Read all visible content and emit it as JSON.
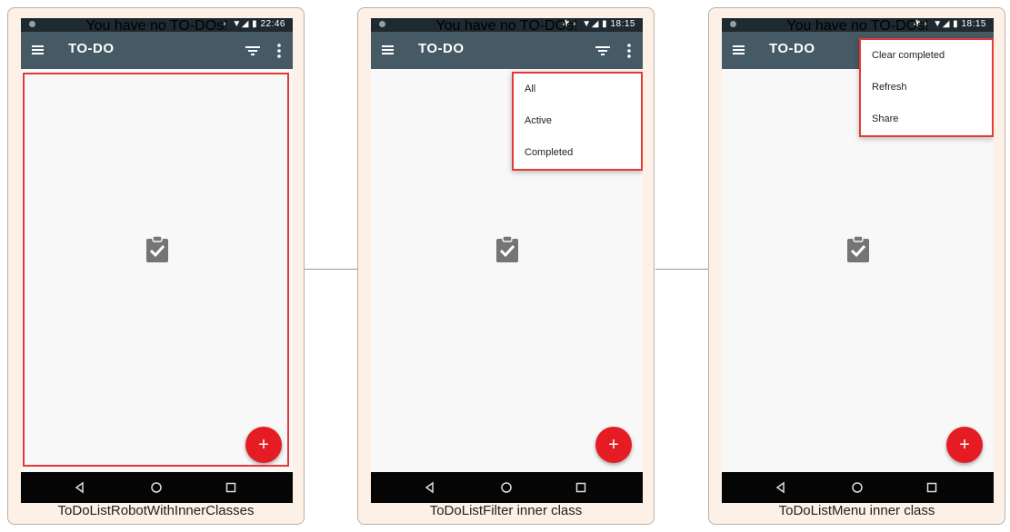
{
  "connectors": [
    "",
    ""
  ],
  "phones": [
    {
      "status_time": "22:46",
      "status_icons": "◐ ▼◢ ▮",
      "toolbar_title": "TO-DO",
      "empty_message": "You have no TO-DOs!",
      "fab_label": "+",
      "caption": "ToDoListRobotWithInnerClasses"
    },
    {
      "status_time": "18:15",
      "status_icons": "✱ ◐ ▼◢ ▮",
      "toolbar_title": "TO-DO",
      "empty_message": "You have no TO-DOs!",
      "fab_label": "+",
      "caption": "ToDoListFilter inner class",
      "popup_items": [
        "All",
        "Active",
        "Completed"
      ]
    },
    {
      "status_time": "18:15",
      "status_icons": "✱ ◐ ▼◢ ▮",
      "toolbar_title": "TO-DO",
      "empty_message": "You have no TO-DOs!",
      "fab_label": "+",
      "caption": "ToDoListMenu inner class",
      "popup_items": [
        "Clear completed",
        "Refresh",
        "Share"
      ]
    }
  ],
  "colors": {
    "card_bg": "#fdf0e6",
    "toolbar": "#455a64",
    "statusbar": "#1e2a30",
    "fab": "#e51c23",
    "highlight": "#e53935"
  },
  "icons": [
    "hamburger-menu-icon",
    "filter-icon",
    "more-vert-icon",
    "clipboard-check-icon",
    "back-icon",
    "home-icon",
    "recents-icon"
  ]
}
